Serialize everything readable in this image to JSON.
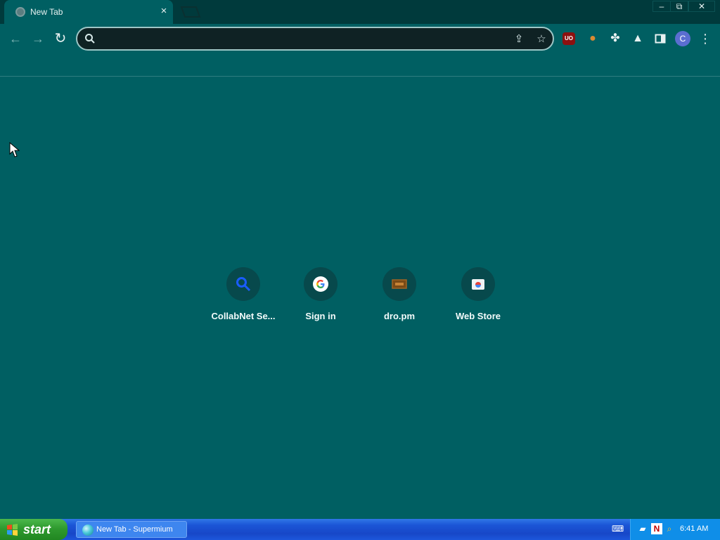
{
  "browser": {
    "tab": {
      "title": "New Tab",
      "close": "×"
    },
    "window_controls": {
      "minimize": "–",
      "maximize": "⧉",
      "close": "✕"
    },
    "nav": {
      "back": "←",
      "forward": "→",
      "reload": "↻"
    },
    "omnibox": {
      "placeholder": "",
      "value": "",
      "share_icon": "share-icon",
      "star_icon": "star-icon"
    },
    "extensions": [
      "ublock-icon",
      "cookie-icon",
      "puzzle-icon",
      "flask-icon",
      "sidebar-icon",
      "profile-avatar",
      "menu-icon"
    ],
    "profile_initial": "C"
  },
  "shortcuts": [
    {
      "label": "CollabNet Se...",
      "icon": "magnifier-icon"
    },
    {
      "label": "Sign in",
      "icon": "google-icon"
    },
    {
      "label": "dro.pm",
      "icon": "dro-icon"
    },
    {
      "label": "Web Store",
      "icon": "webstore-icon"
    }
  ],
  "taskbar": {
    "start": "start",
    "app": "New Tab - Supermium",
    "time": "6:41 AM"
  },
  "colors": {
    "background": "#005f62",
    "titlebar": "#003a3c",
    "taskbar": "#1747c8",
    "start": "#2f9a2f"
  }
}
